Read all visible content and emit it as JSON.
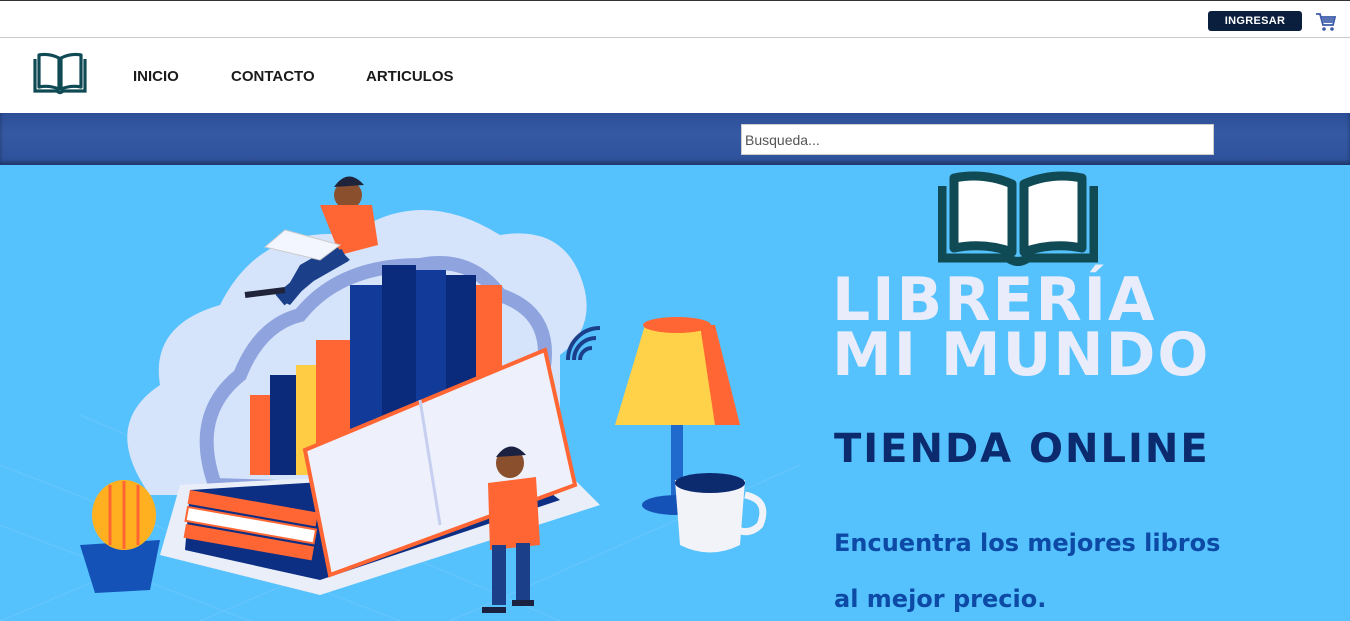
{
  "topbar": {
    "login_label": "INGRESAR",
    "cart_icon": "cart-icon"
  },
  "navbar": {
    "logo_icon": "open-book-icon",
    "links": [
      "INICIO",
      "CONTACTO",
      "ARTICULOS"
    ]
  },
  "search": {
    "placeholder": "Busqueda..."
  },
  "hero": {
    "title_line1": "LIBRERÍA",
    "title_line2": "MI MUNDO",
    "subtitle": "TIENDA ONLINE",
    "tagline_line1": "Encuentra los mejores libros",
    "tagline_line2": "al mejor precio."
  },
  "colors": {
    "login_bg": "#0a1f3d",
    "search_bar": "#3257a1",
    "hero_bg": "#55c1fd",
    "logo_teal": "#0f4a55",
    "title_light": "#e9ecfb",
    "subtitle_dark": "#0c2a6e",
    "tagline_blue": "#0c4aa6"
  }
}
